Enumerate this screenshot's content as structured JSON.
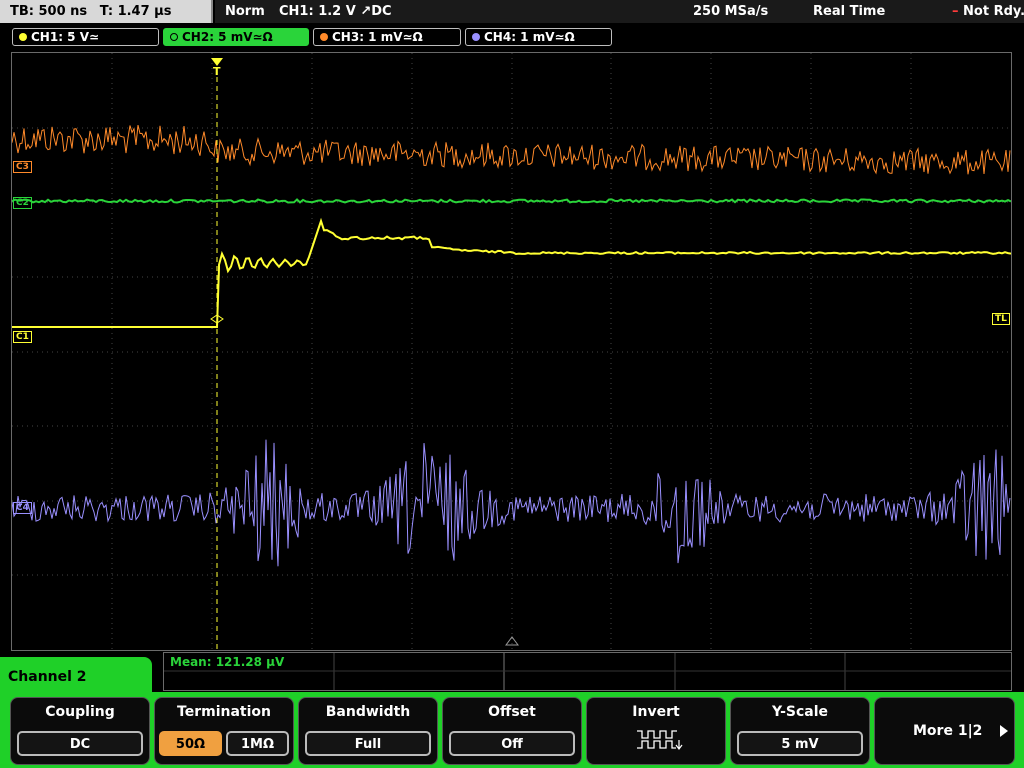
{
  "status": {
    "timebase": "TB: 500 ns",
    "trigger_time": "T: 1.47 µs",
    "mode": "Norm",
    "trigger": "CH1: 1.2 V ↗DC",
    "sample_rate": "250 MSa/s",
    "acq_mode": "Real Time",
    "state": "Not Rdy."
  },
  "channel_tabs": [
    {
      "label": "CH1: 5 V≃",
      "color": "#ffff33"
    },
    {
      "label": "CH2: 5 mV≃Ω",
      "color": "#2ad43a"
    },
    {
      "label": "CH3: 1 mV≃Ω",
      "color": "#ff8a2a"
    },
    {
      "label": "CH4: 1 mV≃Ω",
      "color": "#9a90ff"
    }
  ],
  "markers": {
    "c1": "C1",
    "c2": "C2",
    "c3": "C3",
    "c4": "C4",
    "tl": "TL",
    "trigger": "T"
  },
  "measurement": "Mean: 121.28 µV",
  "panel": {
    "title": "Channel 2",
    "coupling": {
      "label": "Coupling",
      "value": "DC"
    },
    "termination": {
      "label": "Termination",
      "opt_a": "50Ω",
      "opt_b": "1MΩ"
    },
    "bandwidth": {
      "label": "Bandwidth",
      "value": "Full"
    },
    "offset": {
      "label": "Offset",
      "value": "Off"
    },
    "invert": {
      "label": "Invert"
    },
    "yscale": {
      "label": "Y-Scale",
      "value": "5 mV"
    },
    "more": {
      "label": "More 1|2"
    }
  },
  "colors": {
    "ch1": "#ffff33",
    "ch2": "#2ad43a",
    "ch3": "#ff8a2a",
    "ch4": "#9a90ff"
  }
}
